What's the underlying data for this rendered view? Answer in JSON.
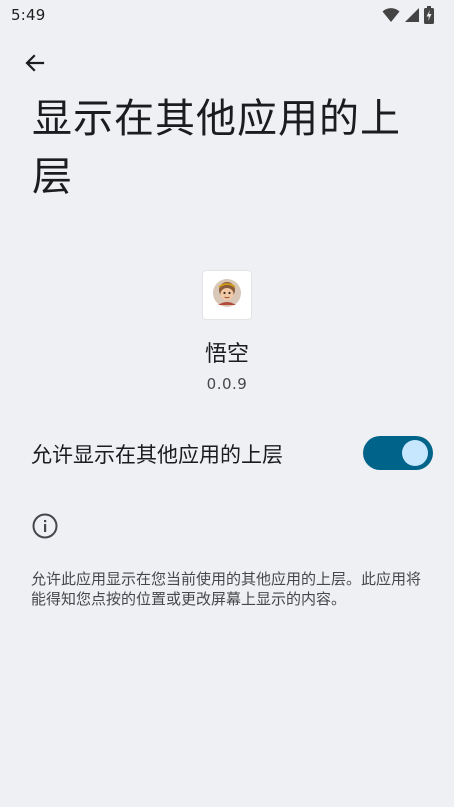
{
  "status_bar": {
    "time": "5:49",
    "icons": [
      "wifi-icon",
      "cell-signal-icon",
      "battery-charging-icon"
    ]
  },
  "header": {
    "back_icon": "arrow-back-icon",
    "title": "显示在其他应用的上层"
  },
  "app": {
    "icon": "app-monkey-avatar-icon",
    "name": "悟空",
    "version": "0.0.9"
  },
  "permission": {
    "label": "允许显示在其他应用的上层",
    "enabled": true,
    "accent_color": "#00648a",
    "thumb_color": "#c7e7ff"
  },
  "info": {
    "icon": "info-icon",
    "text": "允许此应用显示在您当前使用的其他应用的上层。此应用将能得知您点按的位置或更改屏幕上显示的内容。"
  },
  "colors": {
    "background": "#eff0f3",
    "text_primary": "#1b1c1f",
    "text_secondary": "#45474c"
  }
}
